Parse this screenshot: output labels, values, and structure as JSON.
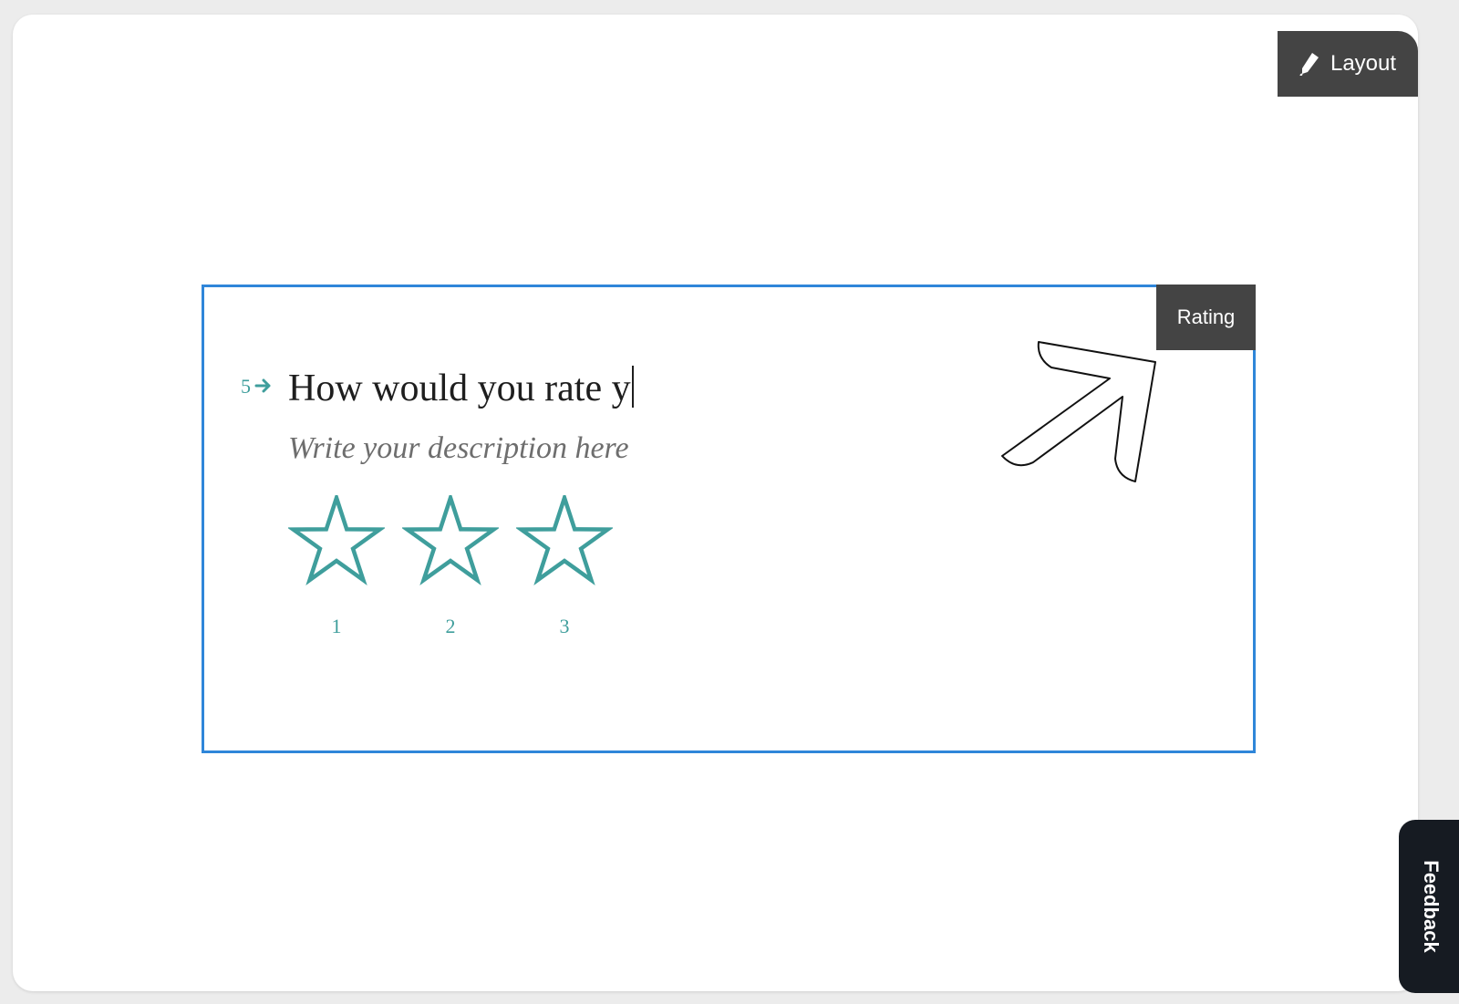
{
  "toolbar": {
    "layout_label": "Layout",
    "layout_icon": "pencil-icon"
  },
  "question": {
    "type_label": "Rating",
    "number": "5",
    "number_icon": "arrow-right-icon",
    "title": "How would you rate y",
    "description_placeholder": "Write your description here",
    "rating_scale": [
      {
        "label": "1"
      },
      {
        "label": "2"
      },
      {
        "label": "3"
      }
    ],
    "star_color": "#3f9e9c"
  },
  "decoration": {
    "arrow_icon": "arrow-up-right-icon"
  },
  "feedback": {
    "label": "Feedback"
  },
  "colors": {
    "selection_border": "#2f86d9",
    "dark_chrome": "#444444",
    "accent": "#3f9e9c"
  }
}
